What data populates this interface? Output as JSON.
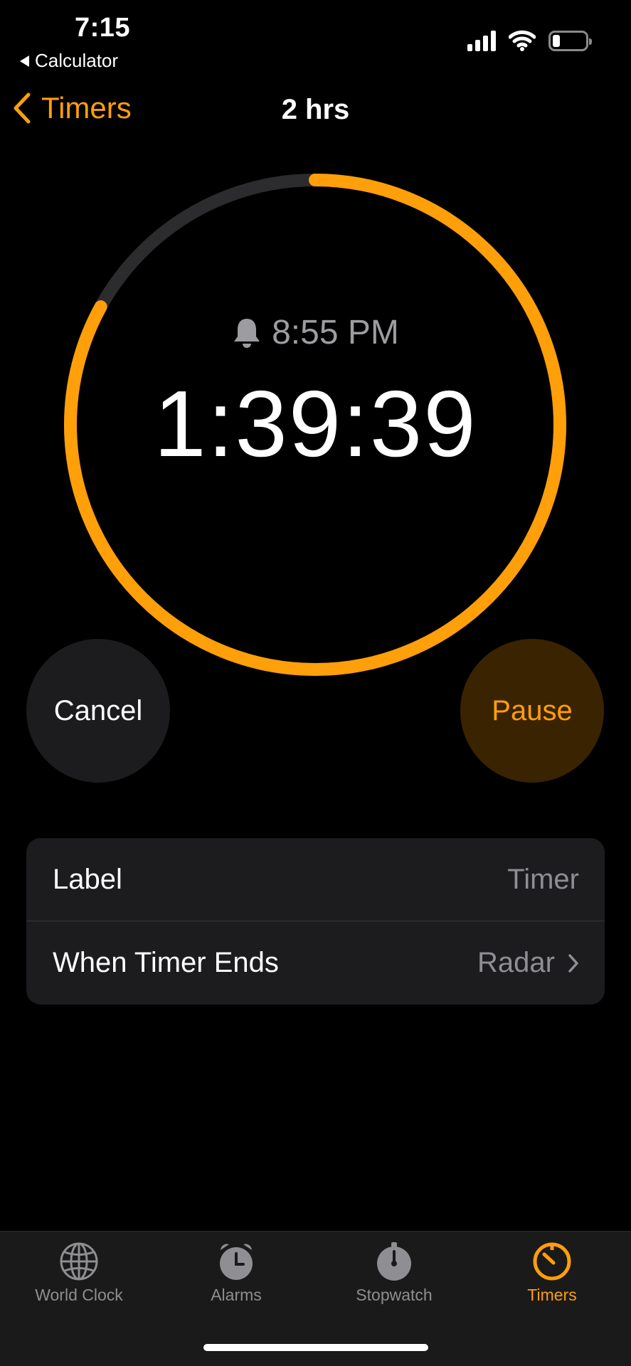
{
  "status_bar": {
    "time": "7:15",
    "back_app": "Calculator",
    "icons": [
      "cellular-signal-icon",
      "wifi-icon",
      "battery-icon"
    ]
  },
  "nav": {
    "back_label": "Timers",
    "title": "2 hrs"
  },
  "timer": {
    "alarm_time": "8:55 PM",
    "countdown": "1:39:39",
    "progress_remaining": 0.83,
    "colors": {
      "accent": "#ff9f0a",
      "track": "#2c2c2e"
    }
  },
  "controls": {
    "cancel": "Cancel",
    "pause": "Pause"
  },
  "settings": {
    "label_title": "Label",
    "label_value": "Timer",
    "ends_title": "When Timer Ends",
    "ends_value": "Radar"
  },
  "tabs": [
    {
      "label": "World Clock",
      "icon": "globe-icon"
    },
    {
      "label": "Alarms",
      "icon": "alarm-clock-icon"
    },
    {
      "label": "Stopwatch",
      "icon": "stopwatch-icon"
    },
    {
      "label": "Timers",
      "icon": "timer-icon",
      "active": true
    }
  ]
}
